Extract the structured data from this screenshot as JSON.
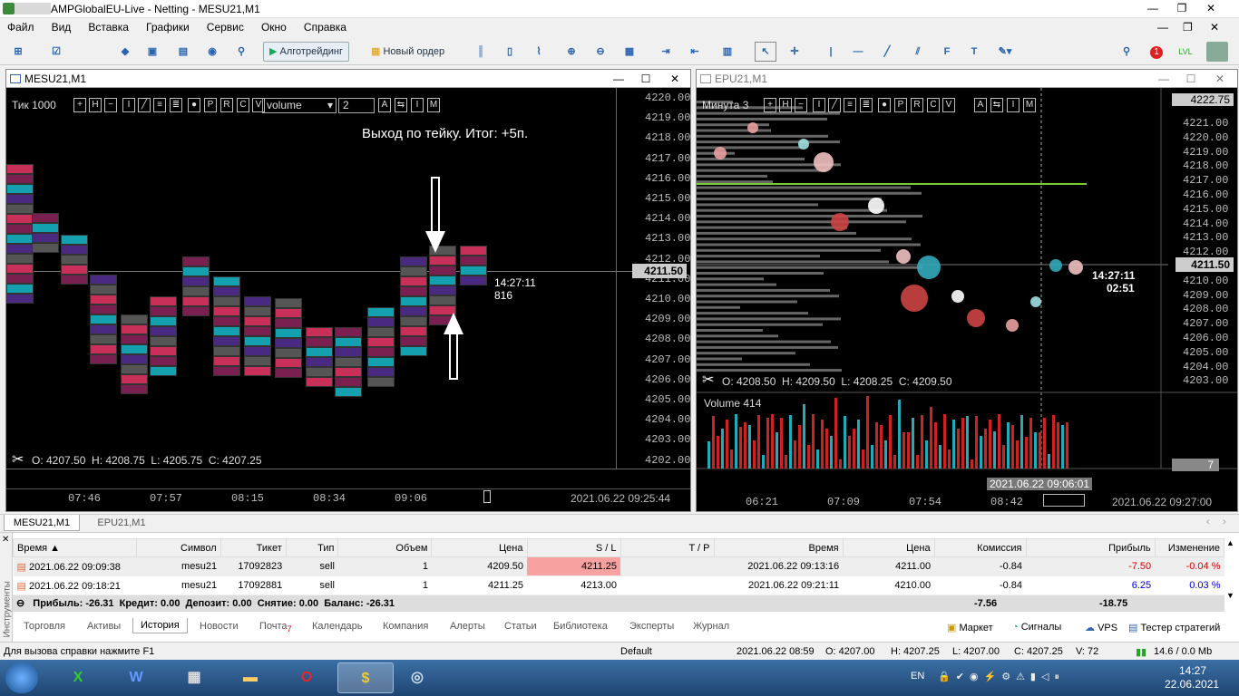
{
  "titlebar": {
    "title": "AMPGlobalEU-Live - Netting - MESU21,M1"
  },
  "menu": [
    "Файл",
    "Вид",
    "Вставка",
    "Графики",
    "Сервис",
    "Окно",
    "Справка"
  ],
  "toolbar": {
    "algo_label": "Алготрейдинг",
    "new_order_label": "Новый ордер",
    "badge_count": "1",
    "lvl_label": "LVL"
  },
  "left_chart": {
    "tab_title": "MESU21,M1",
    "tick_label": "Тик 1000",
    "volume_select": "volume",
    "number_input": "2",
    "annotation": "Выход по тейку. Итог: +5п.",
    "current_price": "4211.50",
    "timer_time": "14:27:11",
    "timer_count": "816",
    "ohlc": "O: 4207.50  H: 4208.75  L: 4205.75  C: 4207.25",
    "y_ticks": [
      "4220.00",
      "4219.00",
      "4218.00",
      "4217.00",
      "4216.00",
      "4215.00",
      "4214.00",
      "4213.00",
      "4212.00",
      "4211.00",
      "4210.00",
      "4209.00",
      "4208.00",
      "4207.00",
      "4206.00",
      "4205.00",
      "4204.00",
      "4203.00",
      "4202.00"
    ],
    "x_ticks": [
      "07:46",
      "07:57",
      "08:15",
      "08:34",
      "09:06"
    ],
    "timestamp": "2021.06.22 09:25:44"
  },
  "right_chart": {
    "tab_title": "EPU21,M1",
    "minute_label": "Минута 3",
    "current_price": "4211.50",
    "top_price": "4222.75",
    "timer_time": "14:27:11",
    "timer_count": "02:51",
    "ohlc": "O: 4208.50  H: 4209.50  L: 4208.25  C: 4209.50",
    "volume_label": "Volume 414",
    "volume_right": "7",
    "y_ticks": [
      "4221.00",
      "4220.00",
      "4219.00",
      "4218.00",
      "4217.00",
      "4216.00",
      "4215.00",
      "4214.00",
      "4213.00",
      "4212.00",
      "4211.00",
      "4210.00",
      "4209.00",
      "4208.00",
      "4207.00",
      "4206.00",
      "4205.00",
      "4204.00",
      "4203.00"
    ],
    "x_ticks": [
      "06:21",
      "07:09",
      "07:54",
      "08:42"
    ],
    "crosshair_time": "2021.06.22 09:06:01",
    "timestamp": "2021.06.22 09:27:00"
  },
  "chart_tabs": [
    "MESU21,M1",
    "EPU21,M1"
  ],
  "history": {
    "headers": [
      "Время",
      "Символ",
      "Тикет",
      "Тип",
      "Объем",
      "Цена",
      "S / L",
      "T / P",
      "Время",
      "Цена",
      "Комиссия",
      "Прибыль",
      "Изменение"
    ],
    "rows": [
      [
        "2021.06.22 09:09:38",
        "mesu21",
        "17092823",
        "sell",
        "1",
        "4209.50",
        "4211.25",
        "",
        "2021.06.22 09:13:16",
        "4211.00",
        "-0.84",
        "-7.50",
        "-0.04 %"
      ],
      [
        "2021.06.22 09:18:21",
        "mesu21",
        "17092881",
        "sell",
        "1",
        "4211.25",
        "4213.00",
        "",
        "2021.06.22 09:21:11",
        "4210.00",
        "-0.84",
        "6.25",
        "0.03 %"
      ]
    ],
    "summary": "Прибыль: -26.31  Кредит: 0.00  Депозит: 0.00  Снятие: 0.00  Баланс: -26.31",
    "summary_commission": "-7.56",
    "summary_profit": "-18.75",
    "side_label": "Инструменты"
  },
  "bottom_tabs": [
    "Торговля",
    "Активы",
    "История",
    "Новости",
    "Почта",
    "Календарь",
    "Компания",
    "Алерты",
    "Статьи",
    "Библиотека",
    "Эксперты",
    "Журнал"
  ],
  "mail_count": "7",
  "right_links": [
    "Маркет",
    "Сигналы",
    "VPS",
    "Тестер стратегий"
  ],
  "status": {
    "help": "Для вызова справки нажмите F1",
    "profile": "Default",
    "time": "2021.06.22 08:59",
    "o": "O: 4207.00",
    "h": "H: 4207.25",
    "l": "L: 4207.00",
    "c": "C: 4207.25",
    "v": "V: 72",
    "net": "14.6 / 0.0 Mb"
  },
  "taskbar": {
    "lang": "EN",
    "clock_time": "14:27",
    "clock_date": "22.06.2021"
  }
}
